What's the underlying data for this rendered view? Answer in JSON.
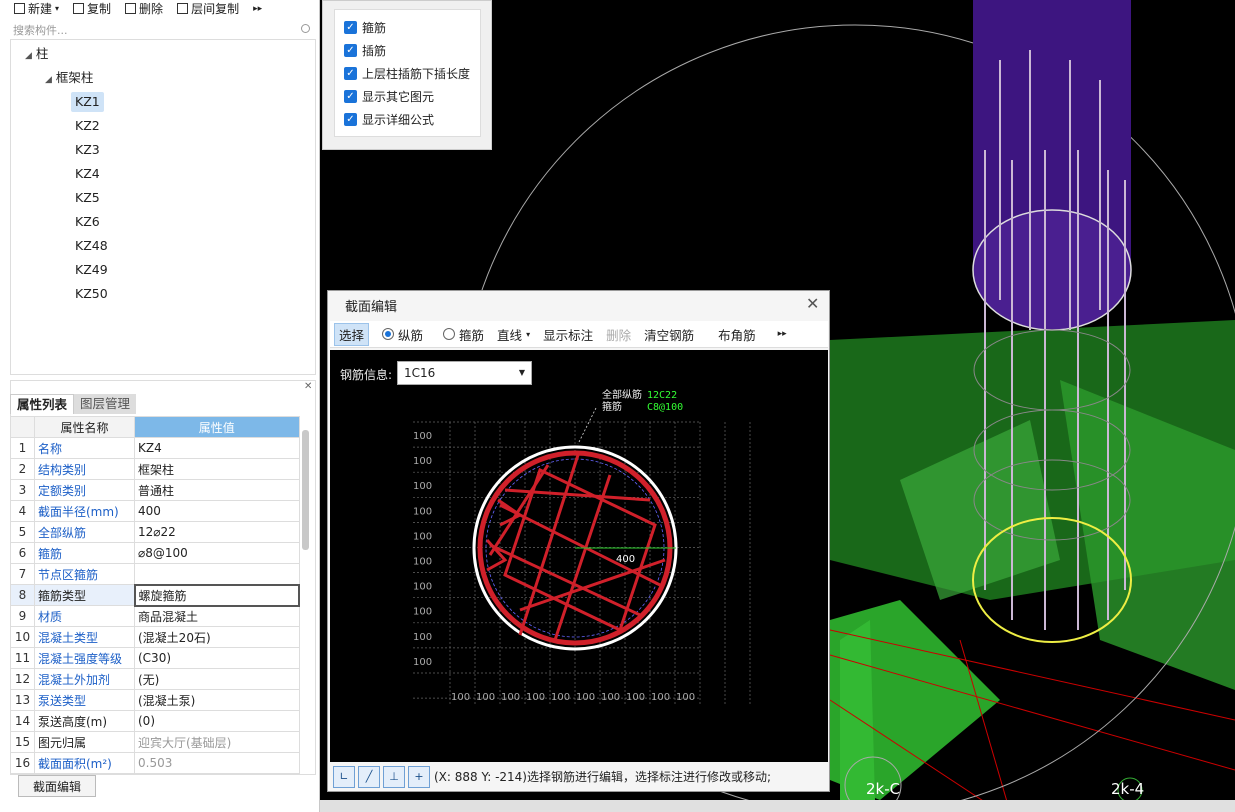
{
  "toolbar": {
    "new": "新建",
    "copy": "复制",
    "delete": "删除",
    "floor_copy": "层间复制"
  },
  "search": {
    "placeholder": "搜索构件..."
  },
  "tree": {
    "root": "柱",
    "group": "框架柱",
    "items": [
      "KZ1",
      "KZ2",
      "KZ3",
      "KZ4",
      "KZ5",
      "KZ6",
      "KZ48",
      "KZ49",
      "KZ50"
    ],
    "selected": "KZ1"
  },
  "props": {
    "tabs": [
      "属性列表",
      "图层管理"
    ],
    "headers": [
      "属性名称",
      "属性值"
    ],
    "rows": [
      {
        "n": "1",
        "k": "名称",
        "v": "KZ4",
        "blue": true
      },
      {
        "n": "2",
        "k": "结构类别",
        "v": "框架柱",
        "blue": true
      },
      {
        "n": "3",
        "k": "定额类别",
        "v": "普通柱",
        "blue": true
      },
      {
        "n": "4",
        "k": "截面半径(mm)",
        "v": "400",
        "blue": true
      },
      {
        "n": "5",
        "k": "全部纵筋",
        "v": "12⌀22",
        "blue": true
      },
      {
        "n": "6",
        "k": "箍筋",
        "v": "⌀8@100",
        "blue": true
      },
      {
        "n": "7",
        "k": "节点区箍筋",
        "v": "",
        "blue": true
      },
      {
        "n": "8",
        "k": "箍筋类型",
        "v": "螺旋箍筋",
        "blue": false
      },
      {
        "n": "9",
        "k": "材质",
        "v": "商品混凝土",
        "blue": true
      },
      {
        "n": "10",
        "k": "混凝土类型",
        "v": "(混凝土20石)",
        "blue": true
      },
      {
        "n": "11",
        "k": "混凝土强度等级",
        "v": "(C30)",
        "blue": true
      },
      {
        "n": "12",
        "k": "混凝土外加剂",
        "v": "(无)",
        "blue": true
      },
      {
        "n": "13",
        "k": "泵送类型",
        "v": "(混凝土泵)",
        "blue": true
      },
      {
        "n": "14",
        "k": "泵送高度(m)",
        "v": "(0)",
        "blue": false
      },
      {
        "n": "15",
        "k": "图元归属",
        "v": "迎宾大厅(基础层)",
        "blue": false
      },
      {
        "n": "16",
        "k": "截面面积(m²)",
        "v": "0.503",
        "blue": true
      }
    ],
    "section_edit_button": "截面编辑"
  },
  "options": [
    "箍筋",
    "插筋",
    "上层柱插筋下插长度",
    "显示其它图元",
    "显示详细公式"
  ],
  "dialog": {
    "title": "截面编辑",
    "tools": {
      "select": "选择",
      "longitudinal": "纵筋",
      "stirrup": "箍筋",
      "line": "直线",
      "show_label": "显示标注",
      "delete": "删除",
      "clear": "清空钢筋",
      "corner": "布角筋"
    },
    "rebar_info_label": "钢筋信息:",
    "rebar_info_value": "1C16",
    "annot_all": "全部纵筋",
    "annot_all_val": "12C22",
    "annot_stirrup": "箍筋",
    "annot_stirrup_val": "C8@100",
    "radius_label": "400",
    "grid_label": "100",
    "status": "(X: 888 Y: -214)选择钢筋进行编辑，选择标注进行修改或移动;"
  },
  "axes": [
    "2k-C",
    "2k-4"
  ],
  "colors": {
    "accent": "#1a73d9",
    "rebar": "#d0202a",
    "green": "#2ea82e",
    "purple": "#4a1a8a"
  }
}
